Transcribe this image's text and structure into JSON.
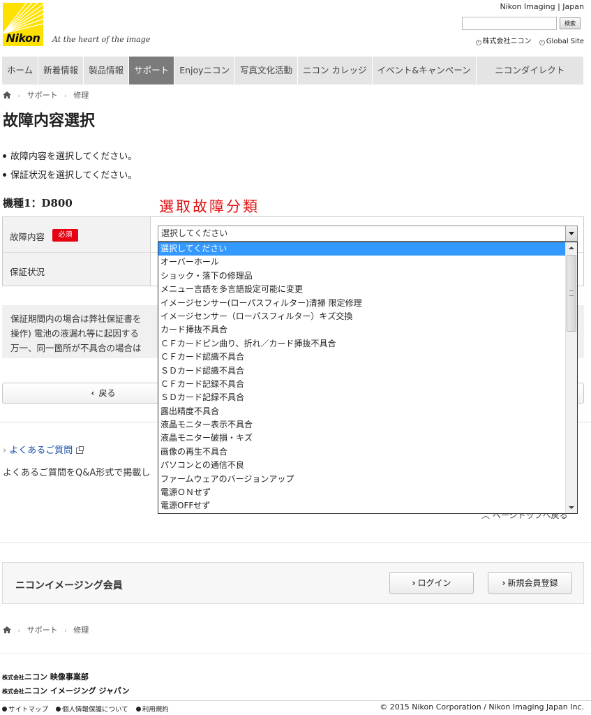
{
  "header": {
    "logo_text": "Nikon",
    "tagline": "At the heart of the image",
    "site_label": "Nikon Imaging | Japan",
    "search_button": "検索",
    "search_value": "",
    "links": [
      "株式会社ニコン",
      "Global Site"
    ]
  },
  "nav": {
    "items": [
      {
        "label": "ホーム",
        "active": false
      },
      {
        "label": "新着情報",
        "active": false
      },
      {
        "label": "製品情報",
        "active": false
      },
      {
        "label": "サポート",
        "active": true
      },
      {
        "label": "Enjoyニコン",
        "active": false
      },
      {
        "label": "写真文化活動",
        "active": false
      },
      {
        "label": "ニコン カレッジ",
        "active": false
      },
      {
        "label": "イベント&キャンペーン",
        "active": false
      },
      {
        "label": "ニコンダイレクト",
        "active": false
      }
    ]
  },
  "breadcrumb": [
    "サポート",
    "修理"
  ],
  "page": {
    "title": "故障内容選択",
    "instructions": [
      "故障内容を選択してください。",
      "保証状況を選択してください。"
    ],
    "model_label": "機種1：D800",
    "annotation": "選取故障分類"
  },
  "form": {
    "fault_label": "故障内容",
    "required_badge": "必須",
    "warranty_label": "保証状況",
    "select_value": "選択してください",
    "options": [
      "選択してください",
      "オーバーホール",
      "ショック・落下の修理品",
      "メニュー言語を多言語設定可能に変更",
      "イメージセンサー(ローパスフィルター)清掃 限定修理",
      "イメージセンサー（ローパスフィルター）キズ交換",
      "カード挿抜不具合",
      "ＣＦカードピン曲り、折れ／カード挿抜不具合",
      "ＣＦカード認識不具合",
      "ＳＤカード認識不具合",
      "ＣＦカード記録不具合",
      "ＳＤカード記録不具合",
      "露出精度不具合",
      "液晶モニター表示不具合",
      "液晶モニター破損・キズ",
      "画像の再生不具合",
      "パソコンとの通信不良",
      "ファームウェアのバージョンアップ",
      "電源ＯＮせず",
      "電源OFFせず"
    ],
    "selected_index": 0
  },
  "info": {
    "lines": [
      "保証期間内の場合は弊社保証書を",
      "操作) 電池の液漏れ等に起因する",
      "万一、同一箇所が不具合の場合は"
    ]
  },
  "buttons": {
    "back": "戻る",
    "pagetop": "ページトップへ戻る",
    "login": "ログイン",
    "register": "新規会員登録"
  },
  "faq": {
    "link": "よくあるご質問",
    "desc": "よくあるご質問をQ&A形式で掲載し"
  },
  "member": {
    "title": "ニコンイメージング会員"
  },
  "footer": {
    "corp1_prefix": "株式会社",
    "corp1_name": "ニコン 映像事業部",
    "corp2_prefix": "株式会社",
    "corp2_name": "ニコン イメージング ジャパン",
    "links": [
      "サイトマップ",
      "個人情報保護について",
      "利用規約"
    ],
    "copyright": "© 2015 Nikon Corporation / Nikon Imaging Japan Inc."
  },
  "colors": {
    "brand_yellow": "#ffe100",
    "nav_bg": "#e4e4e4",
    "nav_active": "#7b7b7b",
    "required_red": "#e60012",
    "annotation_red": "#e01010",
    "selection_blue": "#3399ff",
    "link_blue": "#1a4ea8"
  }
}
